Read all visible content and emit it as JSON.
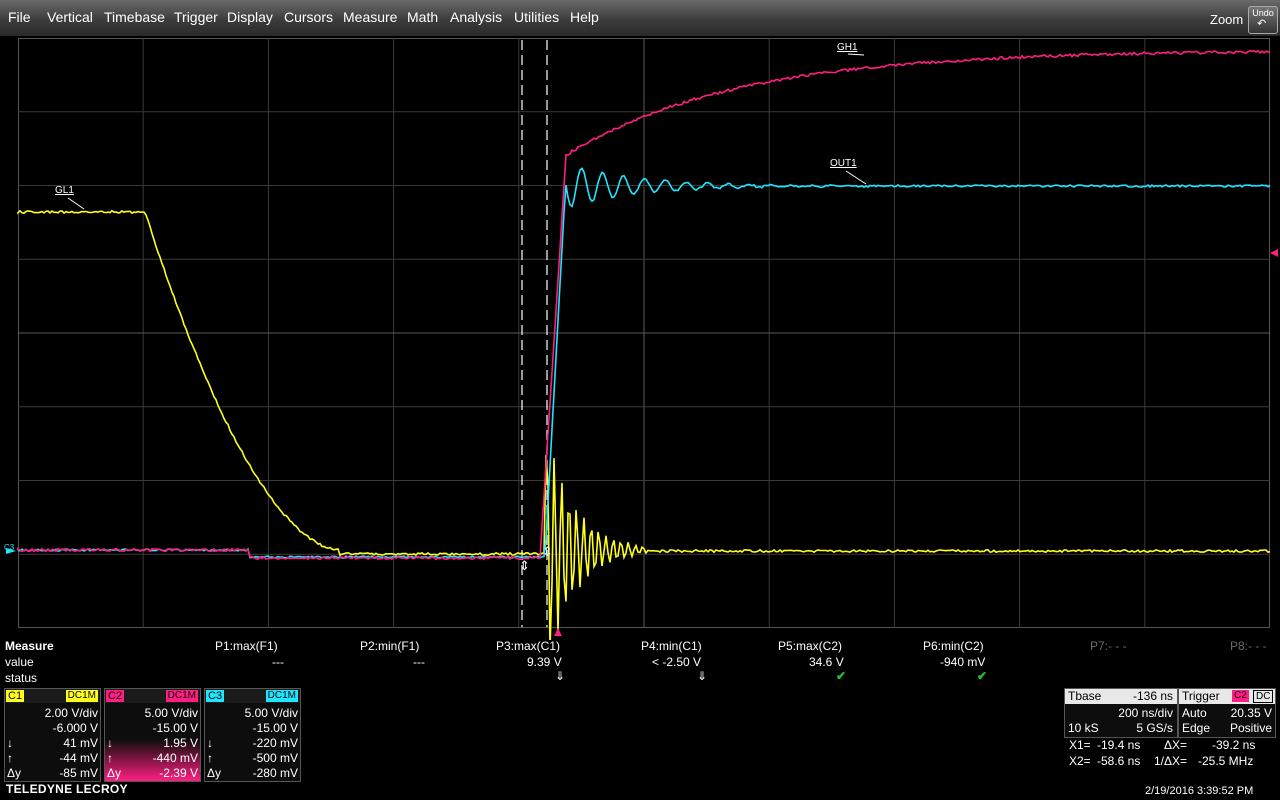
{
  "menu": [
    "File",
    "Vertical",
    "Timebase",
    "Trigger",
    "Display",
    "Cursors",
    "Measure",
    "Math",
    "Analysis",
    "Utilities",
    "Help"
  ],
  "toolbar": {
    "zoom_label": "Zoom",
    "undo_label": "Undo",
    "undo_icon": "undo-arrow-icon"
  },
  "traces": {
    "gl1_label": "GL1",
    "gh1_label": "GH1",
    "out1_label": "OUT1",
    "c3_marker": "C3",
    "colors": {
      "yellow": "#ffff1e",
      "magenta": "#ff1e82",
      "cyan": "#1ee6ff"
    }
  },
  "measure": {
    "title": "Measure",
    "row_value": "value",
    "row_status": "status",
    "columns": [
      {
        "label": "P1:max(F1)",
        "value": "---",
        "status": ""
      },
      {
        "label": "P2:min(F1)",
        "value": "---",
        "status": ""
      },
      {
        "label": "P3:max(C1)",
        "value": "9.39 V",
        "status": "⇓"
      },
      {
        "label": "P4:min(C1)",
        "value": "< -2.50 V",
        "status": "⇓"
      },
      {
        "label": "P5:max(C2)",
        "value": "34.6 V",
        "status": "✔"
      },
      {
        "label": "P6:min(C2)",
        "value": "-940 mV",
        "status": "✔"
      },
      {
        "label": "P7:- - -",
        "value": "",
        "status": ""
      },
      {
        "label": "P8:- - -",
        "value": "",
        "status": ""
      }
    ]
  },
  "channels": [
    {
      "name": "C1",
      "coupling": "DC1M",
      "vdiv": "2.00 V/div",
      "offset": "-6.000 V",
      "c1": "41 mV",
      "c2": "-44 mV",
      "dy": "-85 mV",
      "color": "#ffff1e"
    },
    {
      "name": "C2",
      "coupling": "DC1M",
      "vdiv": "5.00 V/div",
      "offset": "-15.00 V",
      "c1": "1.95 V",
      "c2": "-440 mV",
      "dy": "-2.39 V",
      "color": "#ff1e82"
    },
    {
      "name": "C3",
      "coupling": "DC1M",
      "vdiv": "5.00 V/div",
      "offset": "-15.00 V",
      "c1": "-220 mV",
      "c2": "-500 mV",
      "dy": "-280 mV",
      "color": "#1ee6ff"
    }
  ],
  "cursor_symbols": {
    "down": "↓",
    "up": "↑",
    "dy": "Δy"
  },
  "timebase": {
    "title": "Tbase",
    "delay": "-136 ns",
    "tdiv": "200 ns/div",
    "samples": "10 kS",
    "rate": "5 GS/s"
  },
  "trigger": {
    "title": "Trigger",
    "source": "C2",
    "coupling": "DC",
    "mode": "Auto",
    "level": "20.35 V",
    "type": "Edge",
    "slope": "Positive"
  },
  "cursors": {
    "x1_label": "X1=",
    "x1": "-19.4 ns",
    "dx_label": "ΔX=",
    "dx": "-39.2 ns",
    "x2_label": "X2=",
    "x2": "-58.6 ns",
    "inv_dx_label": "1/ΔX=",
    "inv_dx": "-25.5 MHz"
  },
  "footer": {
    "brand": "TELEDYNE LECROY",
    "datetime": "2/19/2016 3:39:52 PM"
  }
}
